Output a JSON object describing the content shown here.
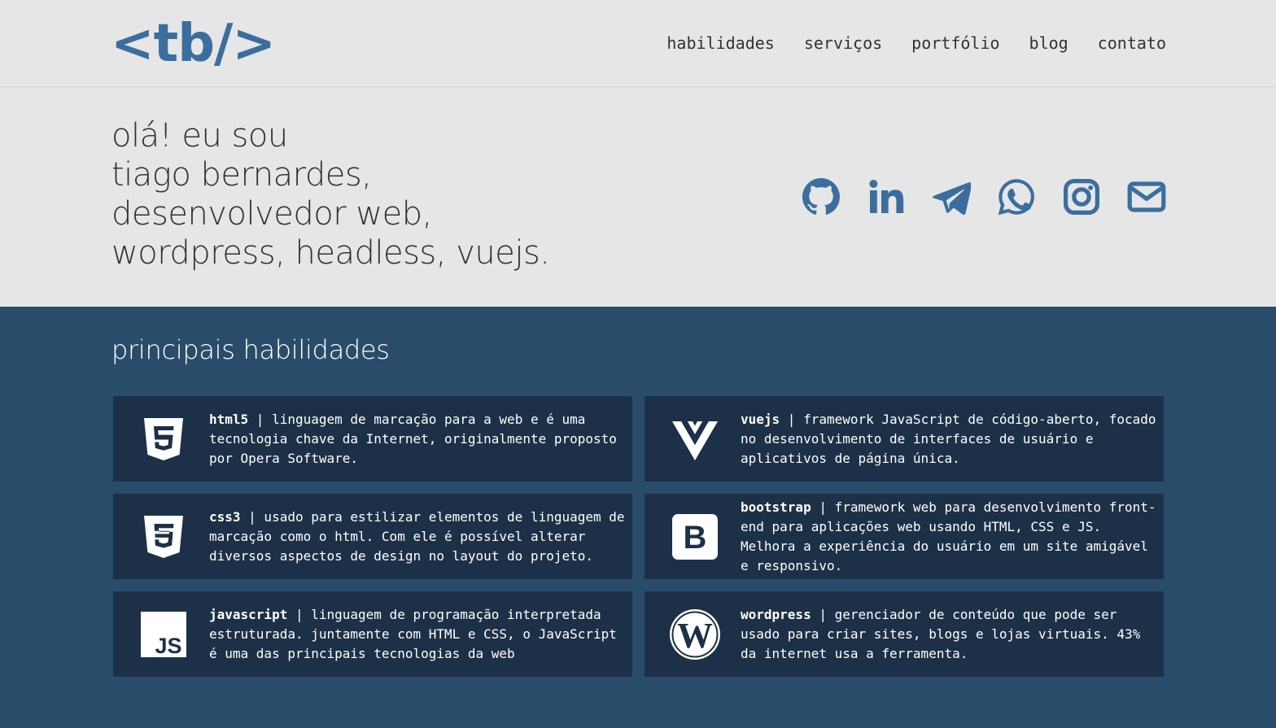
{
  "header": {
    "logo": "<tb/>",
    "nav": [
      "habilidades",
      "serviços",
      "portfólio",
      "blog",
      "contato"
    ]
  },
  "hero": {
    "lines": [
      "olá! eu sou",
      "tiago bernardes,",
      "desenvolvedor web,",
      "wordpress, headless, vuejs."
    ],
    "social_icons": [
      "github-icon",
      "linkedin-icon",
      "telegram-icon",
      "whatsapp-icon",
      "instagram-icon",
      "envelope-icon"
    ]
  },
  "skills": {
    "title": "principais habilidades",
    "items": [
      {
        "icon": "html5-icon",
        "name": "html5",
        "text": " | linguagem de marcação para a web e é uma tecnologia chave da Internet, originalmente proposto por Opera Software."
      },
      {
        "icon": "vuejs-icon",
        "name": "vuejs",
        "text": " | framework JavaScript de código-aberto, focado no desenvolvimento de interfaces de usuário e aplicativos de página única."
      },
      {
        "icon": "css3-icon",
        "name": "css3",
        "text": " | usado para estilizar elementos de linguagem de marcação como o html. Com ele é possível alterar diversos aspectos de design no layout do projeto."
      },
      {
        "icon": "bootstrap-icon",
        "name": "bootstrap",
        "text": " | framework web para desenvolvimento front-end para aplicações web usando HTML, CSS e JS. Melhora a experiência do usuário em um site amigável e responsivo."
      },
      {
        "icon": "javascript-icon",
        "name": "javascript",
        "text": " | linguagem de programação interpretada estruturada. juntamente com HTML e CSS, o JavaScript é uma das principais tecnologias da web"
      },
      {
        "icon": "wordpress-icon",
        "name": "wordpress",
        "text": " | gerenciador de conteúdo que pode ser usado para criar sites, blogs e lojas virtuais. 43% da internet usa a ferramenta."
      }
    ]
  },
  "colors": {
    "accent": "#3b6e9e",
    "dark_bg": "#2a4c6b",
    "card_bg": "#1c3147",
    "light_bg": "#e6e6e6"
  }
}
